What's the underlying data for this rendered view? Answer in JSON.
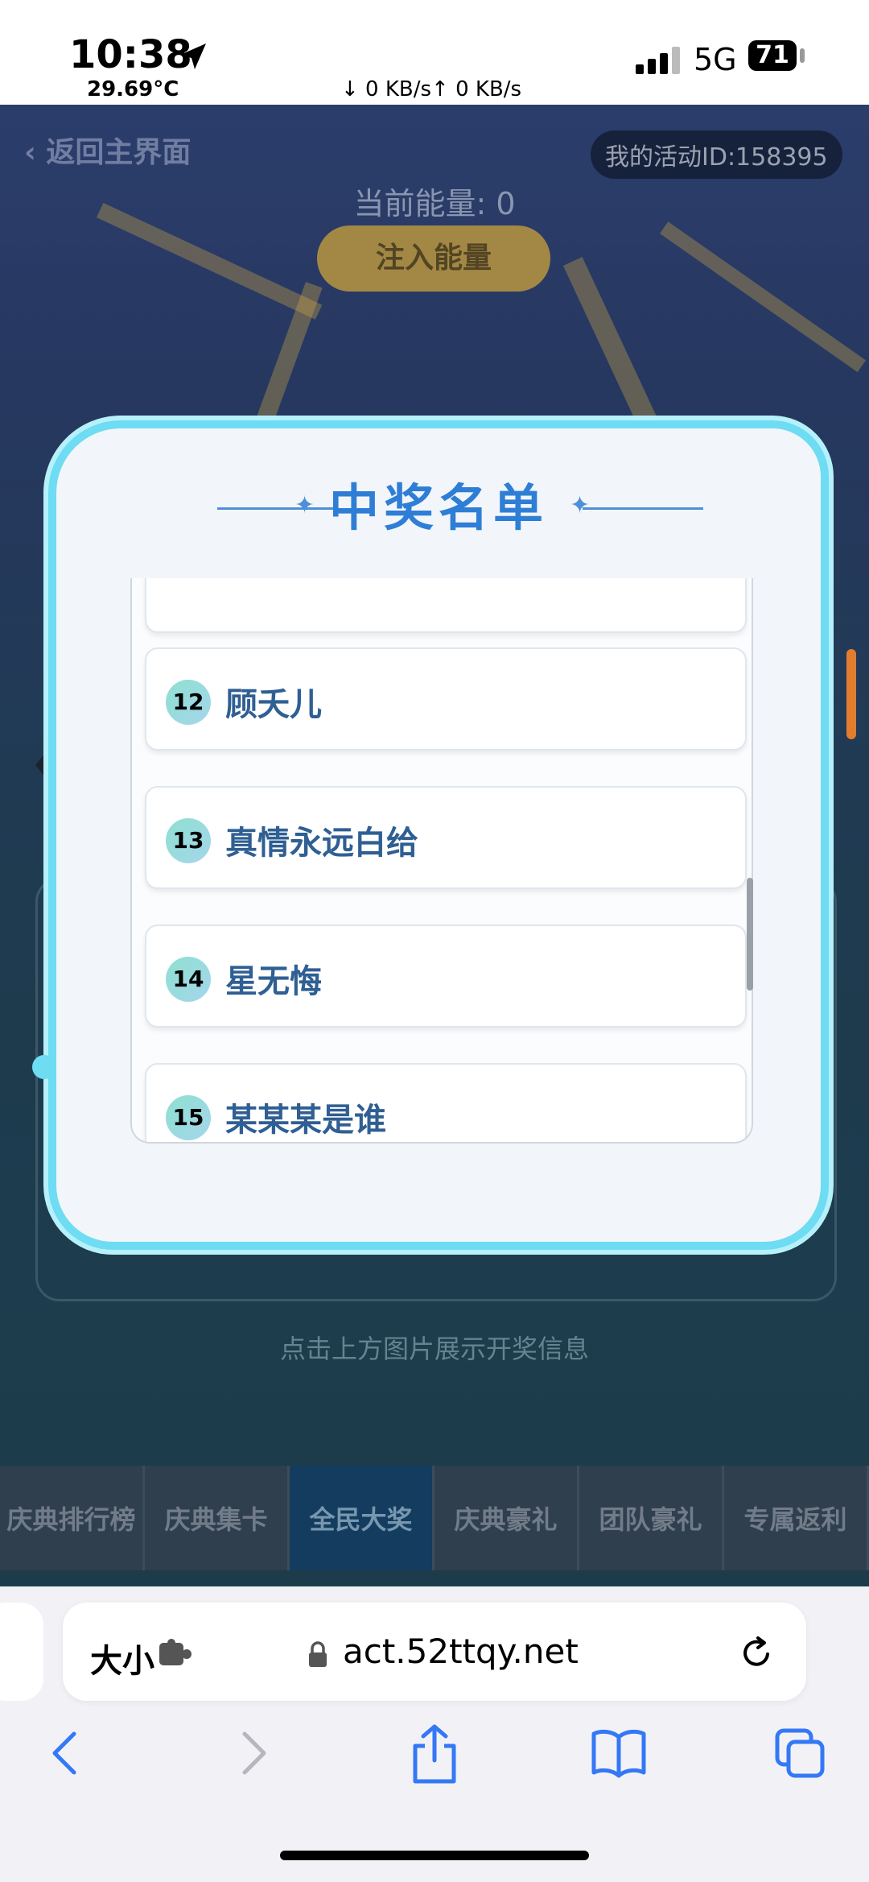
{
  "status_bar": {
    "time": "10:38",
    "temperature": "29.69°C",
    "network_speed": "↓ 0 KB/s↑ 0 KB/s",
    "network_type": "5G",
    "battery": "71"
  },
  "game": {
    "back_label": "返回主界面",
    "activity_id": "我的活动ID:158395",
    "energy_text": "当前能量: 0",
    "inject_button": "注入能量",
    "hint_text": "点击上方图片展示开奖信息",
    "tabs": [
      {
        "label": "庆典排行榜"
      },
      {
        "label": "庆典集卡"
      },
      {
        "label": "全民大奖",
        "active": true
      },
      {
        "label": "庆典豪礼"
      },
      {
        "label": "团队豪礼"
      },
      {
        "label": "专属返利"
      }
    ]
  },
  "popup": {
    "title": "中奖名单",
    "winners": [
      {
        "rank": "12",
        "name": "顾夭儿"
      },
      {
        "rank": "13",
        "name": "真情永远白给"
      },
      {
        "rank": "14",
        "name": "星无悔"
      },
      {
        "rank": "15",
        "name": "某某某是谁"
      }
    ]
  },
  "browser": {
    "size_button": "大小",
    "url": "act.52ttqy.net",
    "icons": [
      "extension-icon",
      "lock-icon",
      "reload-icon",
      "back-icon",
      "forward-icon",
      "share-icon",
      "bookmarks-icon",
      "tabs-icon"
    ]
  },
  "colors": {
    "popup_title": "#2f7ed6",
    "winner_name": "#2f5f93",
    "popup_border": "#6edcf2",
    "safari_blue": "#3478f6"
  }
}
